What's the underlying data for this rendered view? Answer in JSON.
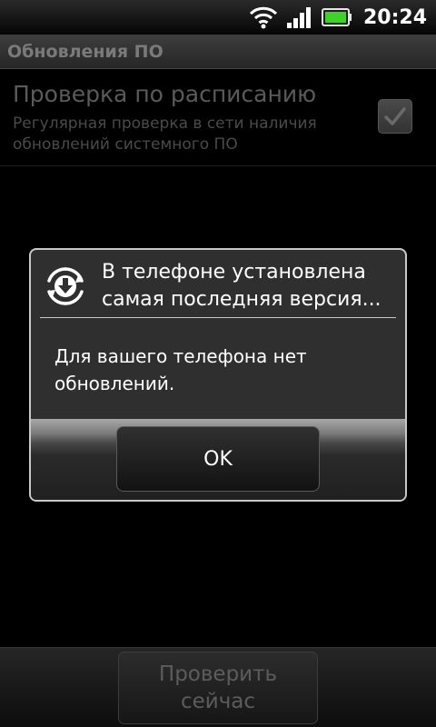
{
  "status_bar": {
    "time": "20:24",
    "icons": [
      "wifi-icon",
      "signal-icon",
      "battery-icon"
    ],
    "battery_color": "#3fd32a"
  },
  "screen_title": "Обновления ПО",
  "preference": {
    "title": "Проверка по расписанию",
    "summary": "Регулярная проверка в сети наличия обновлений системного ПО",
    "checked": true
  },
  "dialog": {
    "icon": "download-refresh-icon",
    "title": "В телефоне установлена самая последняя версия...",
    "message": "Для вашего телефона нет обновлений.",
    "ok_label": "OK"
  },
  "bottom": {
    "check_now_label": "Проверить сейчас"
  }
}
